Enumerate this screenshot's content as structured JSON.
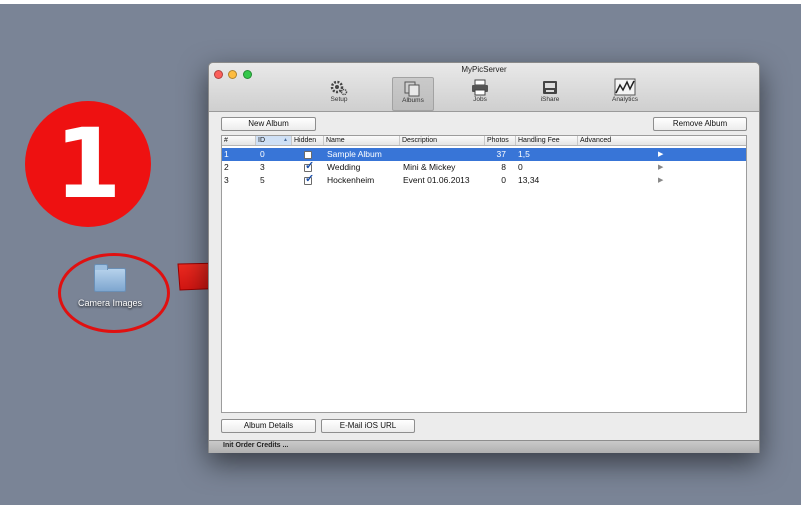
{
  "desktop": {
    "step_number": "1",
    "icon_label": "Camera Images",
    "background": "#7a8496",
    "highlight_color": "#e01010"
  },
  "window": {
    "title": "MyPicServer",
    "toolbar": [
      {
        "label": "Setup",
        "icon": "gear-icon"
      },
      {
        "label": "Albums",
        "icon": "albums-icon",
        "selected": true
      },
      {
        "label": "Jobs",
        "icon": "printer-icon"
      },
      {
        "label": "iShare",
        "icon": "inbox-icon"
      },
      {
        "label": "Analytics",
        "icon": "chart-icon"
      }
    ],
    "new_album_label": "New Album",
    "remove_album_label": "Remove Album",
    "columns": [
      "#",
      "ID",
      "Hidden",
      "Name",
      "Description",
      "Photos",
      "Handling Fee",
      "Advanced"
    ],
    "sorted_column": "ID",
    "rows": [
      {
        "num": "1",
        "id": "0",
        "hidden": false,
        "name": "Sample Album",
        "description": "",
        "photos": "37",
        "fee": "1,5",
        "selected": true
      },
      {
        "num": "2",
        "id": "3",
        "hidden": true,
        "name": "Wedding",
        "description": "Mini & Mickey",
        "photos": "8",
        "fee": "0",
        "selected": false
      },
      {
        "num": "3",
        "id": "5",
        "hidden": true,
        "name": "Hockenheim",
        "description": "Event 01.06.2013",
        "photos": "0",
        "fee": "13,34",
        "selected": false
      }
    ],
    "album_details_label": "Album Details",
    "email_ios_label": "E-Mail iOS URL",
    "status_text": "Init Order Credits ...",
    "selection_color": "#3875d7"
  }
}
